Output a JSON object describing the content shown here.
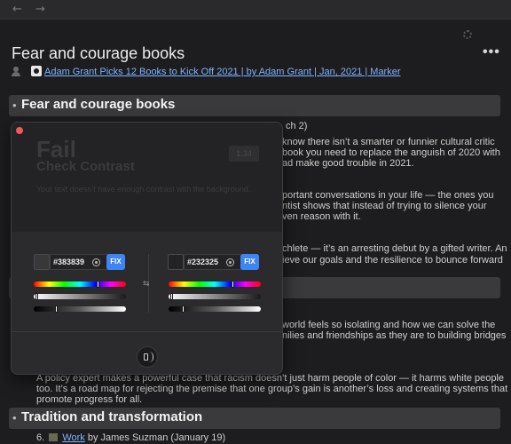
{
  "nav": {
    "back": "←",
    "forward": "→"
  },
  "toolbar": {
    "more": "•••"
  },
  "page": {
    "title": "Fear and courage books",
    "source_link": "Adam Grant Picks 12 Books to Kick Off 2021 | by Adam Grant | Jan, 2021 | Marker"
  },
  "sections": [
    {
      "bullet": "•",
      "heading": "Fear and courage books"
    },
    {
      "bullet": "•",
      "heading": "Tradition and transformation"
    }
  ],
  "body_fragments": {
    "l1": "ch 2)",
    "l2": "know there isn’t a smarter or funnier cultural critic",
    "l3": "book you need to replace the anguish of 2020 with",
    "l4": "ad make good trouble in 2021.",
    "l5": "portant conversations in your life — the ones you",
    "l6": "ntist shows that instead of trying to silence your",
    "l7": "ven reason with it.",
    "l8": "chlete — it’s an arresting debut by a gifted writer. An",
    "l9": "ieve our goals and the resilience to bounce forward",
    "l10": "world feels so isolating and how we can solve the",
    "l11": "nilies and friendships as they are to building bridges",
    "l12": "A policy expert makes a powerful case that racism doesn’t just harm people of color — it harms white people",
    "l13": "too. It’s a road map for rejecting the premise that one group’s gain is another’s loss and creating systems that",
    "l14": "promote progress for all.",
    "item6_prefix": "6.",
    "item6_link": "Work",
    "item6_rest": "by James Suzman (January 19)"
  },
  "contrast_panel": {
    "result": "Fail",
    "title": "Check Contrast",
    "ratio": "1.34",
    "message": "Your text doesn’t have enough contrast with the background.",
    "foreground": {
      "hex": "#383839",
      "fix_label": "FIX",
      "hue": 0.68,
      "alpha": 0.02,
      "gray": 0.23
    },
    "background": {
      "hex": "#232325",
      "fix_label": "FIX",
      "hue": 0.68,
      "alpha": 0.02,
      "gray": 0.14
    },
    "swap_symbol": "⇆"
  },
  "colors": {
    "accent": "#3d84f5",
    "link": "#7fb2ff",
    "close": "#ef5a52",
    "foreground_swatch": "#383839",
    "background_swatch": "#232325"
  },
  "icons": [
    "back-arrow-icon",
    "forward-arrow-icon",
    "gear-icon",
    "more-icon",
    "person-icon",
    "source-icon",
    "eyedropper-icon",
    "swap-icon",
    "speaker-icon"
  ]
}
